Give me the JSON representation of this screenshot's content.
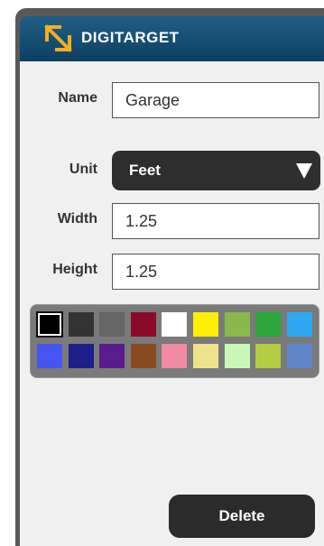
{
  "header": {
    "title": "DIGITARGET"
  },
  "form": {
    "name_label": "Name",
    "name_value": "Garage",
    "unit_label": "Unit",
    "unit_value": "Feet",
    "width_label": "Width",
    "width_value": "1.25",
    "height_label": "Height",
    "height_value": "1.25"
  },
  "palette": {
    "selected": "#000000",
    "colors": [
      "#000000",
      "#333333",
      "#666666",
      "#8b0a2a",
      "#ffffff",
      "#ffee00",
      "#8ab84a",
      "#2aa53a",
      "#2ea8f0",
      "#4455f0",
      "#1c1f8a",
      "#5a1c8c",
      "#8a4a20",
      "#f28aa4",
      "#f0e28a",
      "#c8f8b8",
      "#b2cc44",
      "#5f86c8"
    ]
  },
  "actions": {
    "delete_label": "Delete"
  },
  "colors": {
    "header": "#1b5a80",
    "accent_icon": "#f0b020",
    "panel": "#f0f0f0",
    "frame": "#595959"
  }
}
